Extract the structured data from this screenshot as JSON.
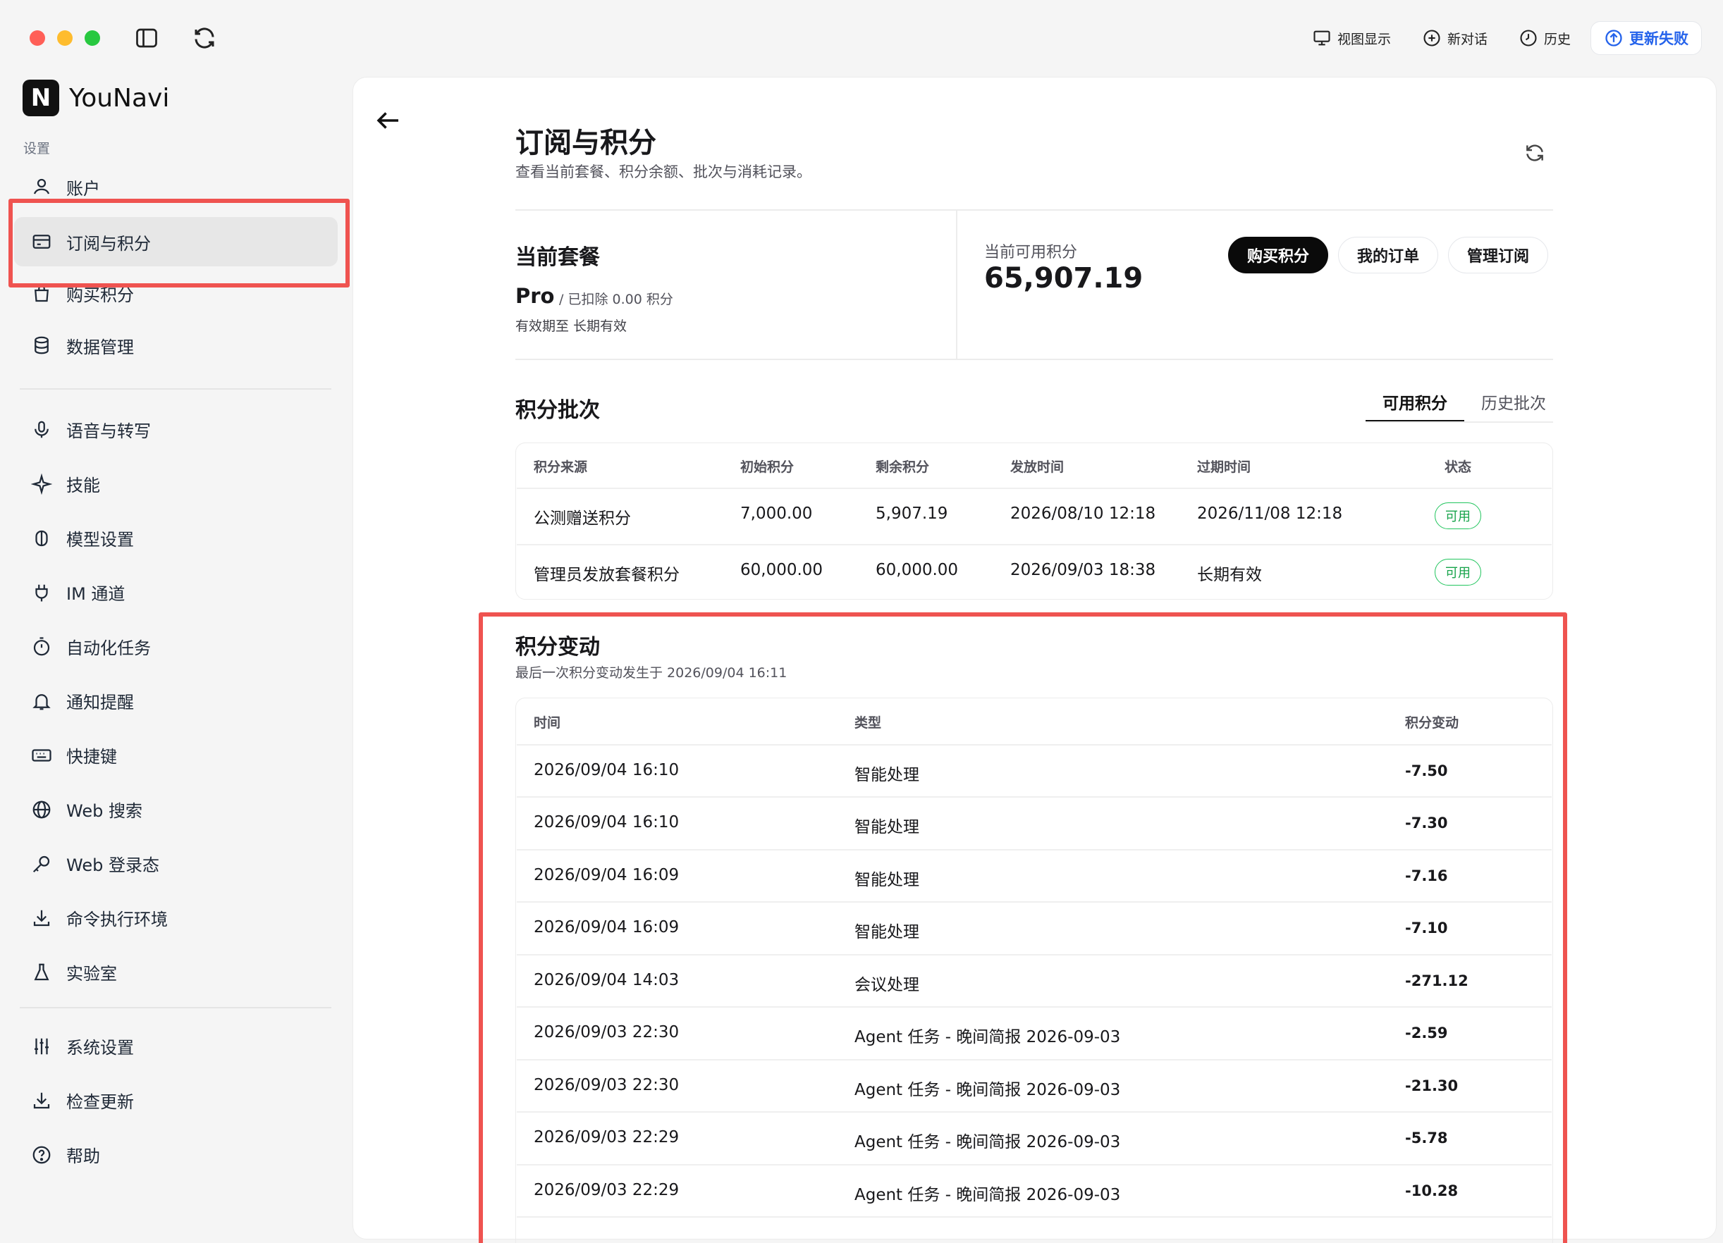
{
  "titlebar": {
    "actions": [
      {
        "label": "视图显示",
        "icon": "monitor-icon"
      },
      {
        "label": "新对话",
        "icon": "plus-circle-icon"
      },
      {
        "label": "历史",
        "icon": "clock-icon"
      }
    ],
    "update_label": "更新失败"
  },
  "sidebar": {
    "brand": "YouNavi",
    "logo_letter": "N",
    "section_label": "设置",
    "group1": [
      {
        "label": "账户",
        "icon": "user-icon"
      },
      {
        "label": "订阅与积分",
        "icon": "card-icon",
        "active": true
      },
      {
        "label": "购买积分",
        "icon": "bag-icon"
      },
      {
        "label": "数据管理",
        "icon": "database-icon"
      }
    ],
    "group2": [
      {
        "label": "语音与转写",
        "icon": "mic-icon"
      },
      {
        "label": "技能",
        "icon": "sparkle-icon"
      },
      {
        "label": "模型设置",
        "icon": "brain-icon"
      },
      {
        "label": "IM 通道",
        "icon": "plug-icon"
      },
      {
        "label": "自动化任务",
        "icon": "timer-icon"
      },
      {
        "label": "通知提醒",
        "icon": "bell-icon"
      },
      {
        "label": "快捷键",
        "icon": "keyboard-icon"
      },
      {
        "label": "Web 搜索",
        "icon": "globe-icon"
      },
      {
        "label": "Web 登录态",
        "icon": "key-icon"
      },
      {
        "label": "命令执行环境",
        "icon": "download-icon"
      },
      {
        "label": "实验室",
        "icon": "flask-icon"
      }
    ],
    "group3": [
      {
        "label": "系统设置",
        "icon": "sliders-icon"
      },
      {
        "label": "检查更新",
        "icon": "download-icon"
      },
      {
        "label": "帮助",
        "icon": "help-icon"
      }
    ]
  },
  "page": {
    "title": "订阅与积分",
    "subtitle": "查看当前套餐、积分余额、批次与消耗记录。"
  },
  "plan": {
    "heading": "当前套餐",
    "name": "Pro",
    "deducted": "/ 已扣除 0.00 积分",
    "expiry": "有效期至 长期有效"
  },
  "credits": {
    "label": "当前可用积分",
    "value": "65,907.19",
    "buttons": {
      "buy": "购买积分",
      "orders": "我的订单",
      "manage": "管理订阅"
    }
  },
  "batches": {
    "heading": "积分批次",
    "tabs": [
      "可用积分",
      "历史批次"
    ],
    "columns": [
      "积分来源",
      "初始积分",
      "剩余积分",
      "发放时间",
      "过期时间",
      "状态"
    ],
    "rows": [
      {
        "source": "公测赠送积分",
        "initial": "7,000.00",
        "remaining": "5,907.19",
        "issued": "2026/08/10 12:18",
        "expires": "2026/11/08 12:18",
        "status": "可用"
      },
      {
        "source": "管理员发放套餐积分",
        "initial": "60,000.00",
        "remaining": "60,000.00",
        "issued": "2026/09/03 18:38",
        "expires": "长期有效",
        "status": "可用"
      }
    ]
  },
  "changes": {
    "heading": "积分变动",
    "subtitle": "最后一次积分变动发生于 2026/09/04 16:11",
    "columns": [
      "时间",
      "类型",
      "积分变动"
    ],
    "rows": [
      {
        "time": "2026/09/04 16:10",
        "type": "智能处理",
        "delta": "-7.50"
      },
      {
        "time": "2026/09/04 16:10",
        "type": "智能处理",
        "delta": "-7.30"
      },
      {
        "time": "2026/09/04 16:09",
        "type": "智能处理",
        "delta": "-7.16"
      },
      {
        "time": "2026/09/04 16:09",
        "type": "智能处理",
        "delta": "-7.10"
      },
      {
        "time": "2026/09/04 14:03",
        "type": "会议处理",
        "delta": "-271.12"
      },
      {
        "time": "2026/09/03 22:30",
        "type": "Agent 任务 - 晚间简报 2026-09-03",
        "delta": "-2.59"
      },
      {
        "time": "2026/09/03 22:30",
        "type": "Agent 任务 - 晚间简报 2026-09-03",
        "delta": "-21.30"
      },
      {
        "time": "2026/09/03 22:29",
        "type": "Agent 任务 - 晚间简报 2026-09-03",
        "delta": "-5.78"
      },
      {
        "time": "2026/09/03 22:29",
        "type": "Agent 任务 - 晚间简报 2026-09-03",
        "delta": "-10.28"
      }
    ]
  },
  "colors": {
    "highlight": "#ef5350",
    "accent": "#2563eb",
    "status_green": "#16a34a"
  }
}
